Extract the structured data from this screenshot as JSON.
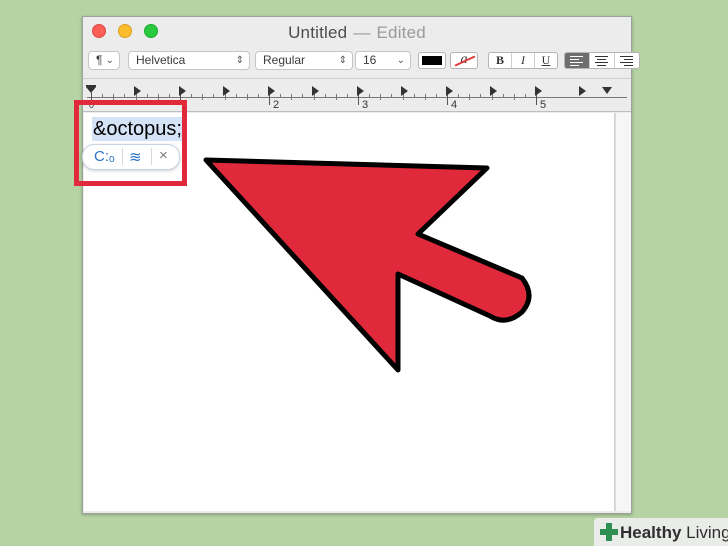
{
  "window": {
    "title": "Untitled",
    "separator": "—",
    "status": "Edited"
  },
  "toolbar": {
    "paragraph_style": "¶",
    "font_family": "Helvetica",
    "font_style": "Regular",
    "font_size": "16",
    "text_color": "#000000",
    "highlight_label": "a",
    "bold_label": "B",
    "italic_label": "I",
    "underline_label": "U"
  },
  "ruler": {
    "labels": [
      "0",
      "2",
      "3",
      "4",
      "5"
    ]
  },
  "document": {
    "typed_text": "&octopus;"
  },
  "autocorrect": {
    "candidate_label": "C:ₒ",
    "alternatives_icon": "wave-lines-icon",
    "dismiss_label": "×"
  },
  "annotation": {
    "highlight_color": "#e0293b",
    "arrow_color": "#e0293b"
  },
  "watermark": {
    "brand_bold": "Healthy",
    "brand_rest": " Living"
  }
}
